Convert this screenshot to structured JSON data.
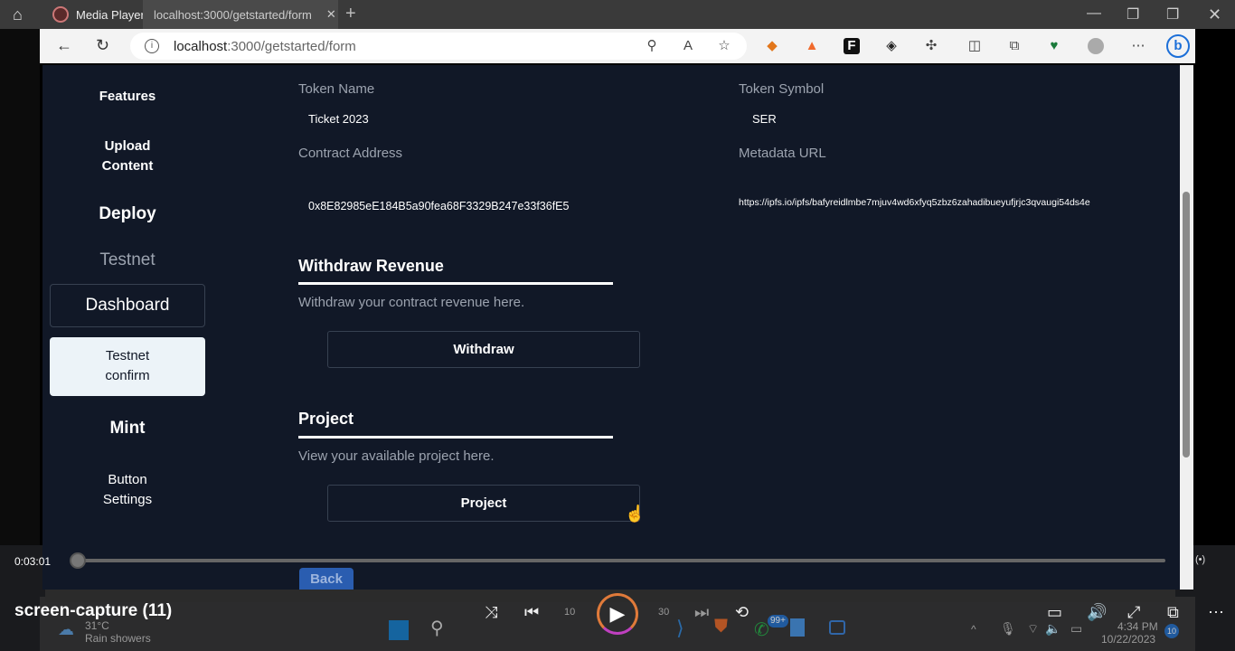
{
  "window": {
    "tabs": [
      {
        "label": "Media Player"
      },
      {
        "label": "localhost:3000/getstarted/form"
      }
    ]
  },
  "browser": {
    "url_host": "localhost",
    "url_path": ":3000/getstarted/form"
  },
  "sidebar": {
    "items": [
      {
        "label": "Features"
      },
      {
        "label": "Upload Content"
      },
      {
        "label": "Deploy"
      },
      {
        "label": "Testnet"
      },
      {
        "label": "Dashboard"
      },
      {
        "label": "Testnet confirm"
      },
      {
        "label": "Mint"
      },
      {
        "label": "Button Settings"
      }
    ]
  },
  "form": {
    "token_name_label": "Token Name",
    "token_name": "Ticket 2023",
    "token_symbol_label": "Token Symbol",
    "token_symbol": "SER",
    "contract_label": "Contract Address",
    "contract": "0x8E82985eE184B5a90fea68F3329B247e33f36fE5",
    "metadata_label": "Metadata URL",
    "metadata": "https://ipfs.io/ipfs/bafyreidlmbe7mjuv4wd6xfyq5zbz6zahadibueyufjrjc3qvaugi54ds4e"
  },
  "withdraw": {
    "title": "Withdraw Revenue",
    "desc": "Withdraw your contract revenue here.",
    "button": "Withdraw"
  },
  "project": {
    "title": "Project",
    "desc": "View your available project here.",
    "button": "Project"
  },
  "back_button": "Back",
  "player": {
    "time": "0:03:01",
    "title": "screen-capture (11)",
    "progress": 0.0,
    "skip_back": "10",
    "skip_fwd": "30"
  },
  "taskbar": {
    "weather_temp": "31°C",
    "weather": "Rain showers",
    "time": "4:34 PM",
    "date": "10/22/2023",
    "badge": "99+",
    "notif": "10"
  }
}
